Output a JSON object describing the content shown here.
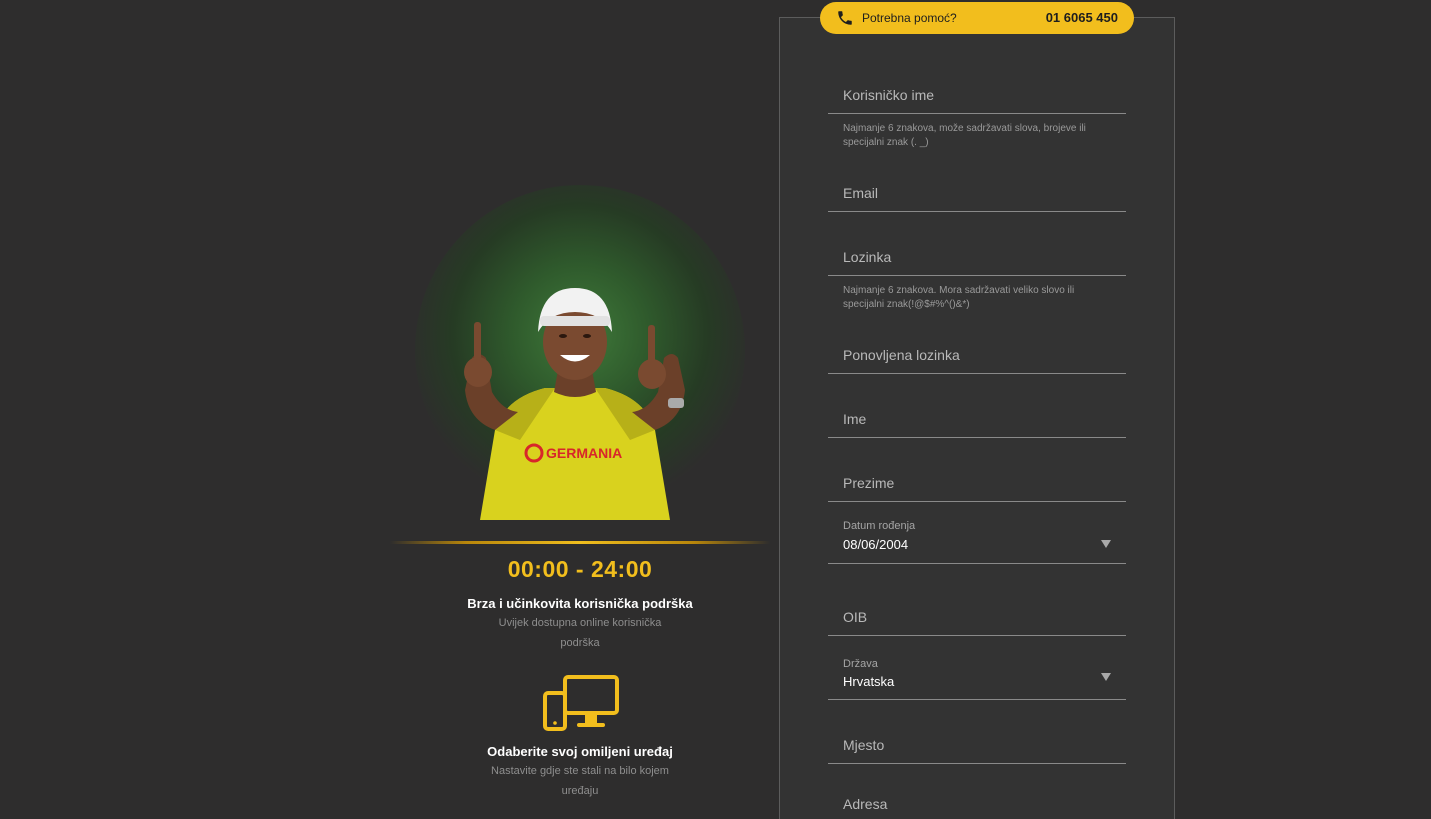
{
  "help": {
    "label": "Potrebna pomoć?",
    "number": "01 6065 450"
  },
  "promo": {
    "hero_logo_text": "GERMANIA",
    "hours": "00:00 - 24:00",
    "features": [
      {
        "title": "Brza i učinkovita korisnička podrška",
        "desc": "Uvijek dostupna online korisnička podrška"
      },
      {
        "title": "Odaberite svoj omiljeni uređaj",
        "desc": "Nastavite gdje ste stali na bilo kojem uređaju"
      }
    ]
  },
  "form": {
    "username_placeholder": "Korisničko ime",
    "username_hint": "Najmanje 6 znakova, može sadržavati slova, brojeve ili specijalni znak (. _)",
    "email_placeholder": "Email",
    "password_placeholder": "Lozinka",
    "password_hint": "Najmanje 6 znakova. Mora sadržavati veliko slovo ili specijalni znak(!@$#%^()&*)",
    "password_repeat_placeholder": "Ponovljena lozinka",
    "first_name_placeholder": "Ime",
    "last_name_placeholder": "Prezime",
    "birthdate_label": "Datum rođenja",
    "birthdate_value": "08/06/2004",
    "oib_placeholder": "OIB",
    "country_label": "Država",
    "country_value": "Hrvatska",
    "city_placeholder": "Mjesto",
    "address_placeholder": "Adresa"
  },
  "colors": {
    "accent": "#f2be1d",
    "background": "#2e2d2d",
    "panel": "#333333"
  },
  "icons": [
    "phone-icon",
    "devices-icon",
    "dropdown-arrow-icon"
  ]
}
